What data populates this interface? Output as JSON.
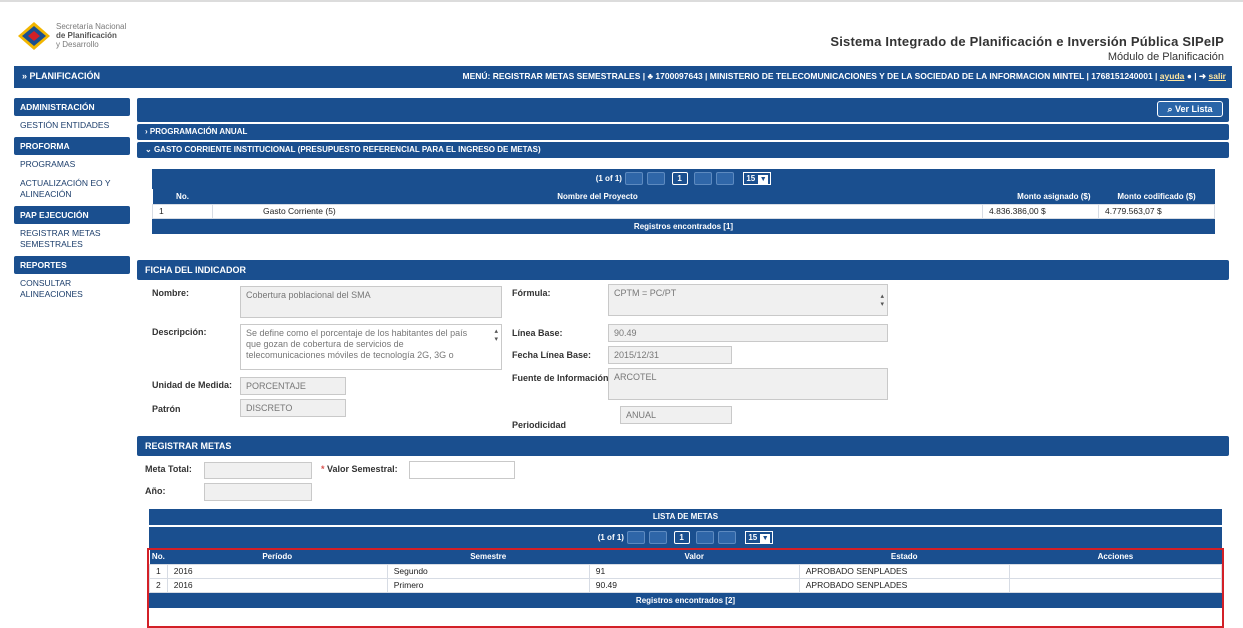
{
  "header": {
    "logo_line1": "Secretaría Nacional",
    "logo_line2": "de Planificación",
    "logo_line3": "y Desarrollo",
    "system_title": "Sistema Integrado de Planificación e Inversión Pública SIPeIP",
    "module": "Módulo de Planificación"
  },
  "topbar": {
    "section": "PLANIFICACIÓN",
    "menu_text": "MENÚ: REGISTRAR METAS SEMESTRALES | ♣ 1700097643 | MINISTERIO DE TELECOMUNICACIONES Y DE LA SOCIEDAD DE LA INFORMACION MINTEL | 1768151240001 | ",
    "help_link": "ayuda",
    "logout_link": "salir"
  },
  "sidebar": {
    "administracion": "ADMINISTRACIÓN",
    "gestion_entidades": "GESTIÓN ENTIDADES",
    "proforma": "PROFORMA",
    "programas": "PROGRAMAS",
    "actualizacion": "ACTUALIZACIÓN EO Y ALINEACIÓN",
    "pap": "PAP EJECUCIÓN",
    "registrar": "REGISTRAR METAS SEMESTRALES",
    "reportes": "REPORTES",
    "consultar": "CONSULTAR ALINEACIONES"
  },
  "main": {
    "ver_lista": "Ver Lista",
    "prog_anual": "PROGRAMACIÓN ANUAL",
    "gasto": "GASTO CORRIENTE INSTITUCIONAL (PRESUPUESTO REFERENCIAL PARA EL INGRESO DE METAS)"
  },
  "proyectos": {
    "page_info": "(1 of 1)",
    "page_num": "1",
    "page_size": "15",
    "headers": [
      "No.",
      "Nombre del Proyecto",
      "Monto asignado ($)",
      "Monto codificado ($)"
    ],
    "rows": [
      {
        "no": "1",
        "nombre": "Gasto Corriente (5)",
        "asignado": "4.836.386,00 $",
        "codificado": "4.779.563,07 $"
      }
    ],
    "footer": "Registros encontrados [1]"
  },
  "ficha": {
    "title": "FICHA DEL INDICADOR",
    "nombre_label": "Nombre:",
    "nombre": "Cobertura poblacional del SMA",
    "descripcion_label": "Descripción:",
    "descripcion": "Se define como el porcentaje de los habitantes del país que gozan de cobertura de servicios de telecomunicaciones móviles de tecnología 2G, 3G o",
    "unidad_label": "Unidad de Medida:",
    "unidad": "PORCENTAJE",
    "patron_label": "Patrón",
    "patron": "DISCRETO",
    "formula_label": "Fórmula:",
    "formula": "CPTM = PC/PT",
    "linea_label": "Línea Base:",
    "linea": "90.49",
    "fecha_label": "Fecha Línea Base:",
    "fecha": "2015/12/31",
    "fuente_label": "Fuente de Información:",
    "fuente": "ARCOTEL",
    "periodicidad_label": "Periodicidad",
    "periodicidad": "ANUAL"
  },
  "registrar": {
    "title": "REGISTRAR METAS",
    "meta_total_label": "Meta Total:",
    "valor_label": "Valor Semestral:",
    "req_mark": "*",
    "anio_label": "Año:"
  },
  "metas": {
    "title": "LISTA DE METAS",
    "page_info": "(1 of 1)",
    "page_num": "1",
    "page_size": "15",
    "headers": [
      "No.",
      "Período",
      "Semestre",
      "Valor",
      "Estado",
      "Acciones"
    ],
    "rows": [
      {
        "no": "1",
        "periodo": "2016",
        "semestre": "Segundo",
        "valor": "91",
        "estado": "APROBADO SENPLADES"
      },
      {
        "no": "2",
        "periodo": "2016",
        "semestre": "Primero",
        "valor": "90.49",
        "estado": "APROBADO SENPLADES"
      }
    ],
    "footer": "Registros encontrados [2]"
  }
}
